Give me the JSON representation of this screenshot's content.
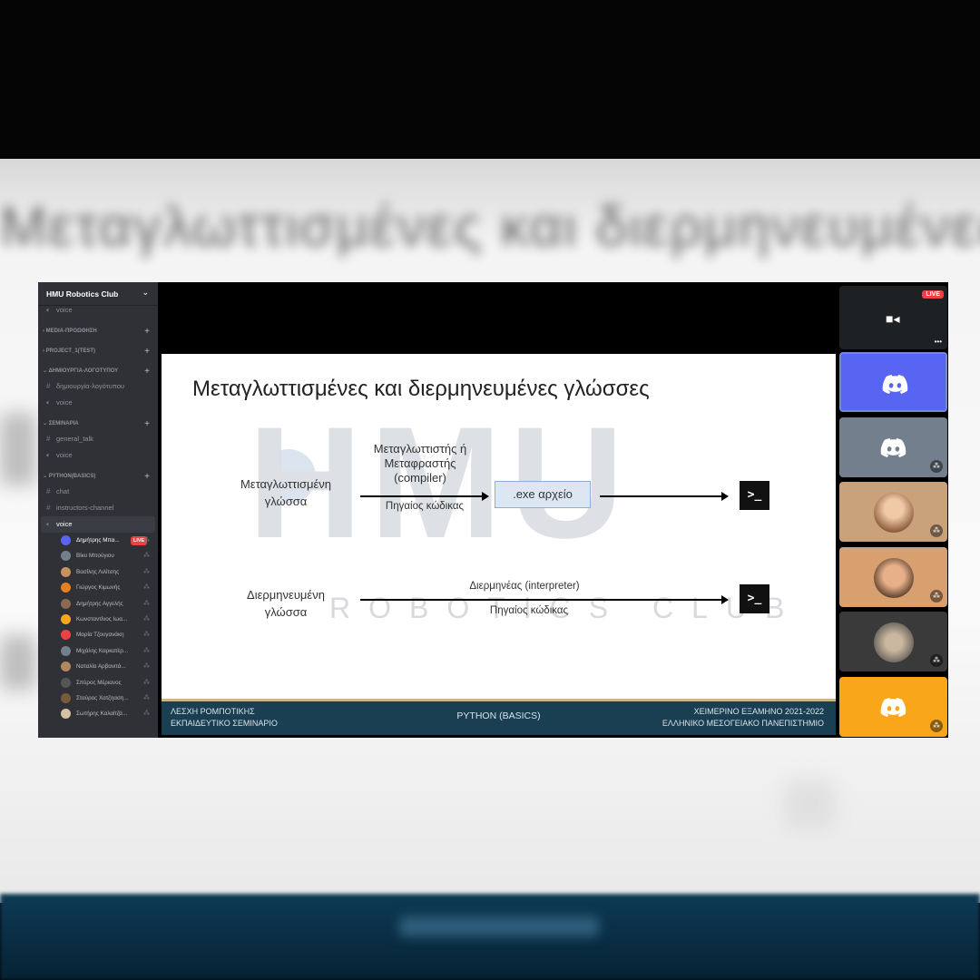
{
  "server": {
    "name": "HMU Robotics Club"
  },
  "sidebar": {
    "top_voice": "voice",
    "categories": [
      {
        "label": "MEDIA-ΠΡΟΩΘΗΣΗ"
      },
      {
        "label": "PROJECT_1(TEST)"
      },
      {
        "label": "ΔΗΜΙΟΥΡΓΙΑ-ΛΟΓΟΤΥΠΟΥ",
        "channels": [
          "δημιουργία-λογότυπου",
          "voice"
        ]
      },
      {
        "label": "ΣΕΜΙΝΑΡΙΑ",
        "channels": [
          "general_talk",
          "voice"
        ]
      },
      {
        "label": "PYTHON(BASICS)",
        "channels": [
          "chat",
          "instructors-channel",
          "voice"
        ]
      }
    ],
    "live_badge": "LIVE",
    "voice_users": [
      "Δημήτρης Μπα...",
      "Βίκυ Μπούγιου",
      "Βασίλης Λιλίτσης",
      "Γιώργος Κιμωνής",
      "Δημήτρης Αγγελής",
      "Κωνσταντίνος Ιωα...",
      "Μαρία Τζουγανάκη",
      "Μιχάλης Καρκατέρ...",
      "Ναταλία Αρβανιτά...",
      "Σπύρος Μέριανος",
      "Σταύρος Χατζηαση...",
      "Σωτήρης Καλαϊτζά..."
    ]
  },
  "slide": {
    "title": "Μεταγλωττισμένες και διερμηνευμένες γλώσσες",
    "watermark": "HMU",
    "watermark_sub": "ROBOTICS CLUB",
    "compiled_label": "Μεταγλωττισμένη\nγλώσσα",
    "compiler_label": "Μεταγλωττιστής ή\nΜεταφραστής\n(compiler)",
    "source_code_1": "Πηγαίος κώδικας",
    "exe_label": ".exe αρχείο",
    "terminal_glyph": ">_",
    "interpreted_label": "Διερμηνευμένη\nγλώσσα",
    "interpreter_label": "Διερμηνέας (interpreter)",
    "source_code_2": "Πηγαίος κώδικας",
    "footer_left_1": "ΛΕΣΧΗ ΡΟΜΠΟΤΙΚΗΣ",
    "footer_left_2": "ΕΚΠΑΙΔΕΥΤΙΚΟ ΣΕΜΙΝΑΡΙΟ",
    "footer_center": "PYTHON (BASICS)",
    "footer_right_1": "ΧΕΙΜΕΡΙΝΟ ΕΞΑΜΗΝΟ 2021-2022",
    "footer_right_2": "ΕΛΛΗΝΙΚΟ ΜΕΣΟΓΕΙΑΚΟ ΠΑΝΕΠΙΣΤΗΜΙΟ"
  },
  "tiles": {
    "preview_live": "LIVE",
    "colors": [
      "#5865f2",
      "#747f8d",
      "#c9a27c",
      "#d9a06f",
      "#3a3a3a",
      "#faa61a"
    ]
  },
  "colors": {
    "discord_blurple": "#5865f2",
    "live_red": "#ed4245",
    "footer_blue": "#1a3f52"
  }
}
